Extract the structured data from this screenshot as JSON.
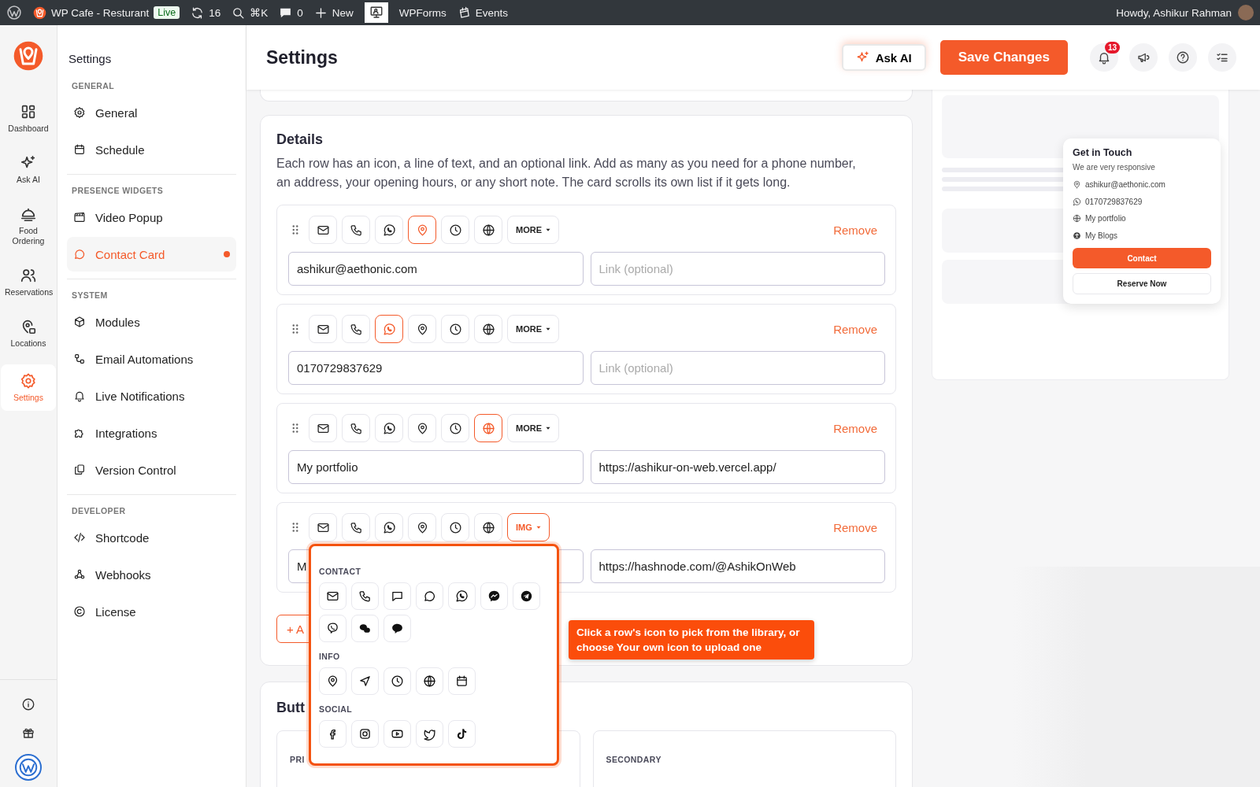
{
  "admin_bar": {
    "items": [
      {
        "kind": "wp"
      },
      {
        "kind": "site",
        "label": "WP Cafe - Resturant",
        "badge": "Live"
      },
      {
        "kind": "updates",
        "label": "16"
      },
      {
        "kind": "search",
        "label": "⌘K"
      },
      {
        "kind": "comments",
        "label": "0"
      },
      {
        "kind": "new",
        "label": "New"
      },
      {
        "kind": "monitor"
      },
      {
        "kind": "text",
        "label": "WPForms"
      },
      {
        "kind": "events",
        "label": "Events"
      }
    ],
    "greeting": "Howdy, Ashikur Rahman"
  },
  "rail": {
    "items": [
      {
        "label": "Dashboard",
        "selected": false
      },
      {
        "label": "Ask AI",
        "selected": false
      },
      {
        "label": "Food Ordering",
        "selected": false
      },
      {
        "label": "Reservations",
        "selected": false
      },
      {
        "label": "Locations",
        "selected": false
      },
      {
        "label": "Settings",
        "selected": true
      }
    ]
  },
  "sidebar": {
    "title": "Settings",
    "groups": [
      {
        "heading": "GENERAL",
        "items": [
          {
            "label": "General",
            "selected": false,
            "unsaved": false
          },
          {
            "label": "Schedule",
            "selected": false,
            "unsaved": false
          }
        ]
      },
      {
        "heading": "PRESENCE WIDGETS",
        "items": [
          {
            "label": "Video Popup",
            "selected": false,
            "unsaved": false
          },
          {
            "label": "Contact Card",
            "selected": true,
            "unsaved": true
          }
        ]
      },
      {
        "heading": "SYSTEM",
        "items": [
          {
            "label": "Modules",
            "selected": false,
            "unsaved": false
          },
          {
            "label": "Email Automations",
            "selected": false,
            "unsaved": false
          },
          {
            "label": "Live Notifications",
            "selected": false,
            "unsaved": false
          },
          {
            "label": "Integrations",
            "selected": false,
            "unsaved": false
          },
          {
            "label": "Version Control",
            "selected": false,
            "unsaved": false
          }
        ]
      },
      {
        "heading": "DEVELOPER",
        "items": [
          {
            "label": "Shortcode",
            "selected": false,
            "unsaved": false
          },
          {
            "label": "Webhooks",
            "selected": false,
            "unsaved": false
          },
          {
            "label": "License",
            "selected": false,
            "unsaved": false
          }
        ]
      }
    ]
  },
  "header": {
    "title": "Settings",
    "ask_ai": "Ask AI",
    "save": "Save Changes",
    "notifications": "13"
  },
  "details": {
    "title": "Details",
    "description": "Each row has an icon, a line of text, and an optional link. Add as many as you need for a phone number, an address, your opening hours, or any short note. The card scrolls its own list if it gets long.",
    "rows": [
      {
        "icons": [
          {
            "selected": false
          },
          {
            "selected": false
          },
          {
            "selected": false
          },
          {
            "selected": true
          },
          {
            "selected": false
          },
          {
            "selected": false
          }
        ],
        "more": {
          "label": "MORE",
          "selected": false
        },
        "text": {
          "value": "ashikur@aethonic.com"
        },
        "link": {
          "placeholder": "Link (optional)"
        },
        "remove": "Remove",
        "picker_open": false
      },
      {
        "icons": [
          {
            "selected": false
          },
          {
            "selected": false
          },
          {
            "selected": true
          },
          {
            "selected": false
          },
          {
            "selected": false
          },
          {
            "selected": false
          }
        ],
        "more": {
          "label": "MORE",
          "selected": false
        },
        "text": {
          "value": "0170729837629"
        },
        "link": {
          "placeholder": "Link (optional)"
        },
        "remove": "Remove",
        "picker_open": false
      },
      {
        "icons": [
          {
            "selected": false
          },
          {
            "selected": false
          },
          {
            "selected": false
          },
          {
            "selected": false
          },
          {
            "selected": false
          },
          {
            "selected": true
          }
        ],
        "more": {
          "label": "MORE",
          "selected": false
        },
        "text": {
          "value": "My portfolio"
        },
        "link": {
          "value": "https://ashikur-on-web.vercel.app/"
        },
        "remove": "Remove",
        "picker_open": false
      },
      {
        "icons": [
          {
            "selected": false
          },
          {
            "selected": false
          },
          {
            "selected": false
          },
          {
            "selected": false
          },
          {
            "selected": false
          },
          {
            "selected": false
          }
        ],
        "more": {
          "label": "IMG",
          "selected": true
        },
        "text": {
          "value": "M"
        },
        "link": {
          "value": "https://hashnode.com/@AshikOnWeb"
        },
        "remove": "Remove",
        "picker_open": true
      }
    ],
    "picker": {
      "sections": [
        {
          "heading": "CONTACT"
        },
        {
          "heading": "INFO"
        },
        {
          "heading": "SOCIAL"
        }
      ]
    },
    "add_button": "+ A",
    "tooltip": "Click a row's icon to pick from the library, or choose Your own icon to upload one"
  },
  "buttons_section": {
    "title": "Butt",
    "columns": [
      {
        "label": "PRI"
      },
      {
        "label": "SECONDARY"
      }
    ]
  },
  "preview": {
    "card": {
      "title": "Get in Touch",
      "subtitle": "We are very responsive",
      "lines": [
        {
          "text": "ashikur@aethonic.com"
        },
        {
          "text": "0170729837629"
        },
        {
          "text": "My portfolio"
        },
        {
          "text": "My Blogs"
        }
      ],
      "primary": "Contact",
      "secondary": "Reserve Now"
    }
  }
}
